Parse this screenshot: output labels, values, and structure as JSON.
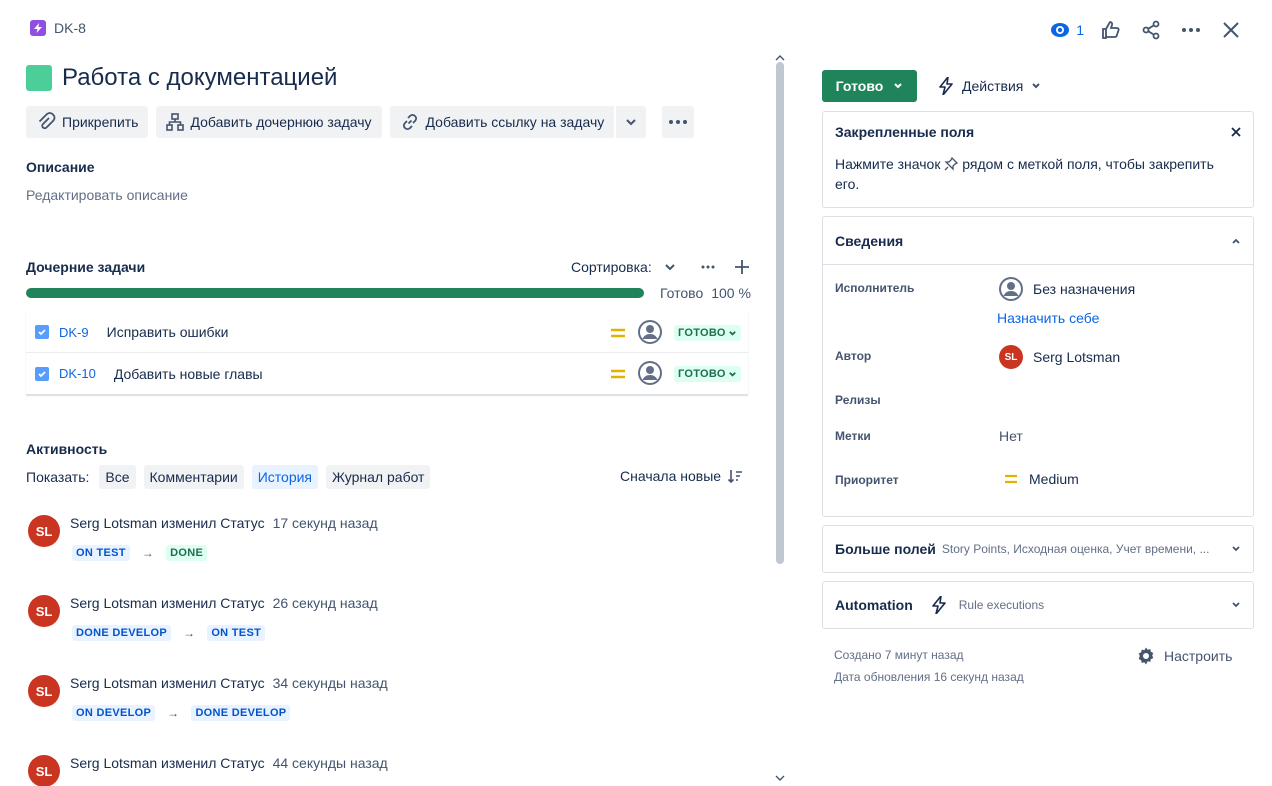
{
  "header": {
    "issue_key": "DK-8",
    "watchers_count": "1",
    "title": "Работа с документацией"
  },
  "toolbar": {
    "attach": "Прикрепить",
    "add_child": "Добавить дочернюю задачу",
    "add_link": "Добавить ссылку на задачу"
  },
  "description": {
    "heading": "Описание",
    "placeholder": "Редактировать описание"
  },
  "child_issues": {
    "heading": "Дочерние задачи",
    "sort_label": "Сортировка:",
    "progress_label": "Готово",
    "progress_percent": "100 %",
    "progress_value": 1.0,
    "items": [
      {
        "key": "DK-9",
        "summary": "Исправить ошибки",
        "status": "ГОТОВО"
      },
      {
        "key": "DK-10",
        "summary": "Добавить новые главы",
        "status": "ГОТОВО"
      }
    ]
  },
  "activity": {
    "heading": "Активность",
    "show_label": "Показать:",
    "filters": [
      "Все",
      "Комментарии",
      "История",
      "Журнал работ"
    ],
    "active_filter": "История",
    "sort_label": "Сначала новые",
    "entries": [
      {
        "avatar": "SL",
        "text": "Serg Lotsman изменил Статус",
        "time": "17 секунд назад",
        "from": "ON TEST",
        "to": "DONE"
      },
      {
        "avatar": "SL",
        "text": "Serg Lotsman изменил Статус",
        "time": "26 секунд назад",
        "from": "DONE DEVELOP",
        "to": "ON TEST"
      },
      {
        "avatar": "SL",
        "text": "Serg Lotsman изменил Статус",
        "time": "34 секунды назад",
        "from": "ON DEVELOP",
        "to": "DONE DEVELOP"
      },
      {
        "avatar": "SL",
        "text": "Serg Lotsman изменил Статус",
        "time": "44 секунды назад",
        "from": "",
        "to": ""
      }
    ],
    "arrow": "→"
  },
  "sidebar": {
    "status_button": "Готово",
    "actions_button": "Действия",
    "pinned": {
      "heading": "Закрепленные поля",
      "text_before": "Нажмите значок",
      "text_after": "рядом с меткой поля, чтобы закрепить его."
    },
    "details": {
      "heading": "Сведения",
      "assignee_label": "Исполнитель",
      "assignee_value": "Без назначения",
      "assign_to_me": "Назначить себе",
      "reporter_label": "Автор",
      "reporter_value": "Serg Lotsman",
      "reporter_avatar": "SL",
      "releases_label": "Релизы",
      "labels_label": "Метки",
      "labels_value": "Нет",
      "priority_label": "Приоритет",
      "priority_value": "Medium"
    },
    "more_fields": {
      "heading": "Больше полей",
      "summary": "Story Points, Исходная оценка, Учет времени, ..."
    },
    "automation": {
      "heading": "Automation",
      "sub": "Rule executions"
    },
    "created": "Создано 7 минут назад",
    "updated": "Дата обновления 16 секунд назад",
    "configure": "Настроить"
  },
  "colors": {
    "accent": "#0c66e4",
    "done_green": "#1f845a",
    "priority_medium": "#e2b203",
    "avatar_red": "#ca3521"
  }
}
